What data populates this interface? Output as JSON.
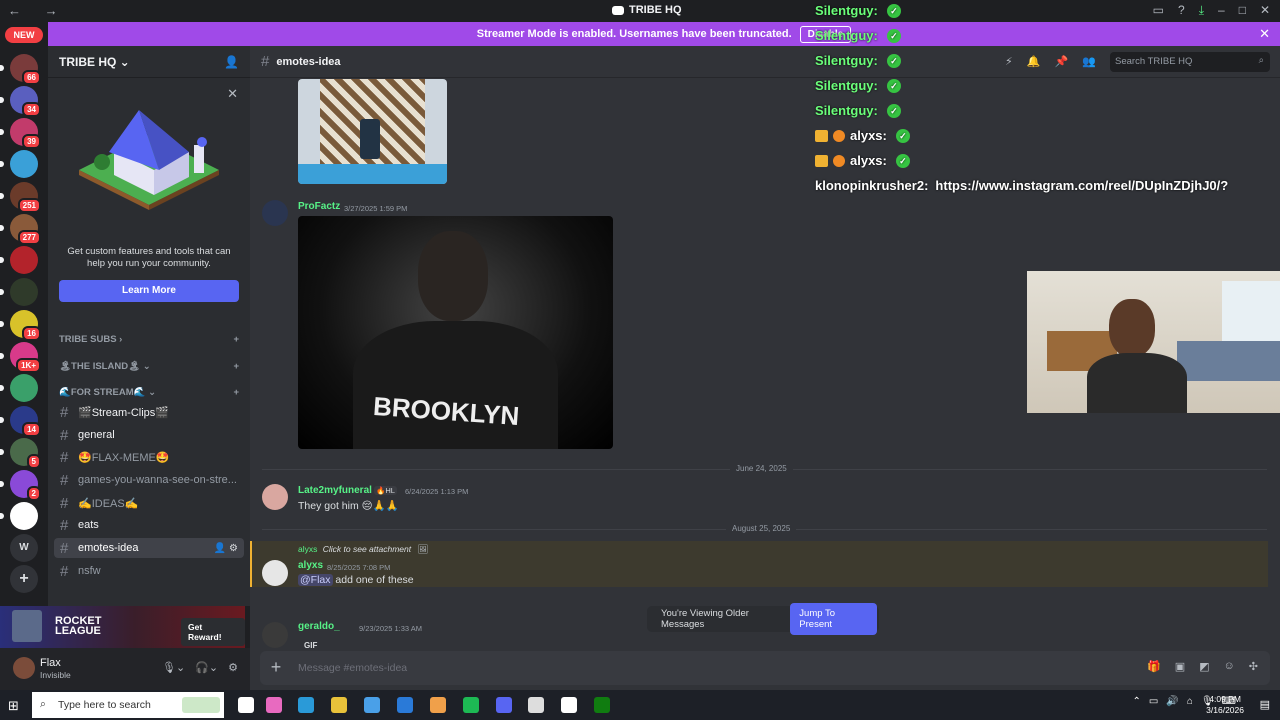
{
  "titlebar": {
    "title": "TRIBE HQ",
    "nav": "← →"
  },
  "banner": {
    "text": "Streamer Mode is enabled. Usernames have been truncated.",
    "disable_label": "Disable",
    "close": "✕"
  },
  "new_badge": "NEW",
  "guilds": [
    {
      "count": "66",
      "color": "#7a3b3b"
    },
    {
      "count": "34",
      "color": "#5a5fbf"
    },
    {
      "count": "39",
      "color": "#c23b6b"
    },
    {
      "count": "",
      "color": "#3aa0d8"
    },
    {
      "count": "251",
      "color": "#6b3b2a"
    },
    {
      "count": "277",
      "color": "#8a5a3a"
    },
    {
      "count": "",
      "color": "#b3232b"
    },
    {
      "count": "",
      "color": "#2f3a2a"
    },
    {
      "count": "16",
      "color": "#d8c22a"
    },
    {
      "count": "1K+",
      "color": "#d83a8a"
    },
    {
      "count": "",
      "color": "#3aa06a"
    },
    {
      "count": "14",
      "color": "#2a3a8a"
    },
    {
      "count": "5",
      "color": "#4a6a4a"
    },
    {
      "count": "2",
      "color": "#8a4ad8"
    },
    {
      "count": "",
      "color": "#ffffff"
    }
  ],
  "guild_text": {
    "w": "W",
    "add": "+"
  },
  "sidebar": {
    "server_name": "TRIBE HQ ⌄",
    "promo_text": "Get custom features and tools that can help you run your community.",
    "promo_button": "Learn More",
    "categories": [
      {
        "label": "TRIBE SUBS ›",
        "add": "+"
      },
      {
        "label": "🏝THE ISLAND🏝 ⌄",
        "add": "+"
      },
      {
        "label": "🌊FOR STREAM🌊 ⌄",
        "add": "+"
      }
    ],
    "channels": [
      {
        "name": "🎬Stream-Clips🎬",
        "bright": true
      },
      {
        "name": "general",
        "bright": true
      },
      {
        "name": "🤩FLAX-MEME🤩",
        "bright": false
      },
      {
        "name": "games-you-wanna-see-on-stre...",
        "bright": false
      },
      {
        "name": "✍️IDEAS✍️",
        "bright": false
      },
      {
        "name": "eats",
        "bright": true
      },
      {
        "name": "emotes-idea",
        "bright": true,
        "selected": true
      },
      {
        "name": "nsfw",
        "bright": false
      }
    ]
  },
  "rocket": {
    "name": "ROCKET LEAGUE",
    "reward": "Get Reward!"
  },
  "user": {
    "name": "Flax",
    "status": "Invisible"
  },
  "channel_header": {
    "name": "emotes-idea",
    "search_placeholder": "Search TRIBE HQ"
  },
  "messages": [
    {
      "author": "ProFactz",
      "time": "3/27/2025 1:59 PM",
      "color": "#57f287"
    },
    {
      "author": "Late2myfuneral",
      "badge": "🔥HL",
      "time": "6/24/2025 1:13 PM",
      "text": "They got him 😔🙏🙏",
      "color": "#57f287"
    },
    {
      "author": "alyxs",
      "time": "8/25/2025 7:08 PM",
      "reply_author": "alyxs",
      "reply_text": "Click to see attachment",
      "mention": "@Flax",
      "text": " add one of these",
      "color": "#57f287"
    },
    {
      "author": "geraldo_",
      "time": "9/23/2025 1:33 AM",
      "text": "GIF",
      "color": "#57f287"
    }
  ],
  "dividers": [
    "June 24, 2025",
    "August 25, 2025"
  ],
  "jump": {
    "text": "You're Viewing Older Messages",
    "button": "Jump To Present"
  },
  "composer": {
    "placeholder": "Message #emotes-idea"
  },
  "overlay": {
    "lines": [
      {
        "name": "Silentguy:",
        "text": ""
      },
      {
        "name": "Silentguy:",
        "text": ""
      },
      {
        "name": "Silentguy:",
        "text": ""
      },
      {
        "name": "Silentguy:",
        "text": ""
      },
      {
        "name": "Silentguy:",
        "text": ""
      },
      {
        "name": "alyxs:",
        "text": ""
      },
      {
        "name": "alyxs:",
        "text": ""
      },
      {
        "name": "klonopinkrusher2:",
        "text": "https://www.instagram.com/reel/DUpInZDjhJ0/?"
      }
    ]
  },
  "taskbar": {
    "search": "Type here to search",
    "time": "4:09 PM",
    "date": "3/16/2026"
  }
}
